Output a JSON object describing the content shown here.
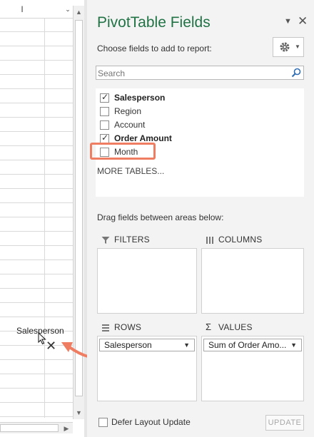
{
  "sheet": {
    "column_header": "I",
    "drag_label": "Salesperson"
  },
  "pane": {
    "title": "PivotTable Fields",
    "choose_label": "Choose fields to add to report:",
    "search_placeholder": "Search",
    "fields": [
      {
        "label": "Salesperson",
        "checked": true
      },
      {
        "label": "Region",
        "checked": false
      },
      {
        "label": "Account",
        "checked": false
      },
      {
        "label": "Order Amount",
        "checked": true
      },
      {
        "label": "Month",
        "checked": false
      }
    ],
    "more_tables": "MORE TABLES...",
    "drag_hint": "Drag fields between areas below:",
    "areas": {
      "filters": {
        "title": "FILTERS"
      },
      "columns": {
        "title": "COLUMNS"
      },
      "rows": {
        "title": "ROWS",
        "item": "Salesperson"
      },
      "values": {
        "title": "VALUES",
        "item": "Sum of Order Amo..."
      }
    },
    "defer_label": "Defer Layout Update",
    "update_label": "UPDATE"
  },
  "colors": {
    "title_green": "#217346",
    "highlight": "#ef7d62"
  }
}
